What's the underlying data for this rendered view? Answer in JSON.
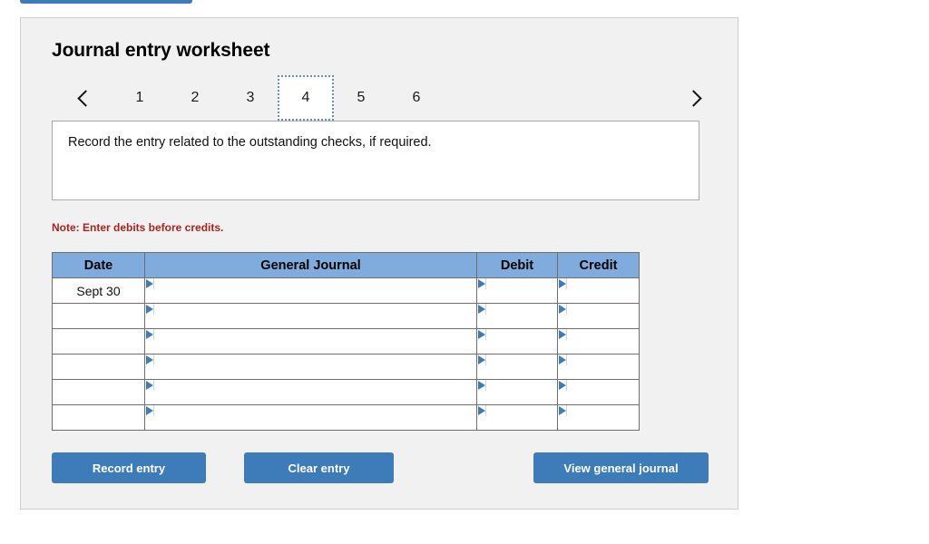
{
  "top_button": {
    "label": ""
  },
  "panel": {
    "title": "Journal entry worksheet",
    "pager": {
      "prev_icon": "chevron-left-icon",
      "next_icon": "chevron-right-icon",
      "tabs": [
        "1",
        "2",
        "3",
        "4",
        "5",
        "6"
      ],
      "active_tab": "4"
    },
    "prompt": {
      "text": "Record the entry related to the outstanding checks, if required."
    },
    "note": "Note: Enter debits before credits.",
    "table": {
      "columns": [
        "Date",
        "General Journal",
        "Debit",
        "Credit"
      ],
      "rows": [
        {
          "date": "Sept 30",
          "general_journal": "",
          "debit": "",
          "credit": ""
        },
        {
          "date": "",
          "general_journal": "",
          "debit": "",
          "credit": ""
        },
        {
          "date": "",
          "general_journal": "",
          "debit": "",
          "credit": ""
        },
        {
          "date": "",
          "general_journal": "",
          "debit": "",
          "credit": ""
        },
        {
          "date": "",
          "general_journal": "",
          "debit": "",
          "credit": ""
        },
        {
          "date": "",
          "general_journal": "",
          "debit": "",
          "credit": ""
        }
      ]
    },
    "buttons": {
      "record": "Record entry",
      "clear": "Clear entry",
      "view": "View general journal"
    }
  },
  "colors": {
    "button_blue": "#3E7CB9",
    "header_blue": "#7FACDC",
    "note_red": "#AF2121",
    "active_tab_border": "#5C8FC4",
    "panel_bg": "#F1F1F1"
  }
}
